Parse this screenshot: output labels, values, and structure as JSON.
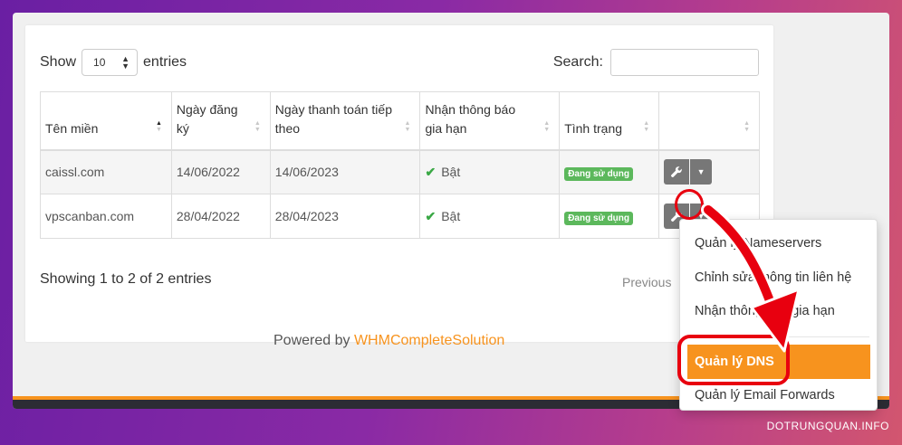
{
  "controls": {
    "show_label": "Show",
    "entries_value": "10",
    "entries_label": "entries",
    "search_label": "Search:",
    "search_value": ""
  },
  "table": {
    "headers": [
      "Tên miền",
      "Ngày đăng ký",
      "Ngày thanh toán tiếp theo",
      "Nhận thông báo gia hạn",
      "Tình trạng",
      ""
    ],
    "rows": [
      {
        "domain": "caissl.com",
        "registered": "14/06/2022",
        "next_due": "14/06/2023",
        "renewal_notice": "Bật",
        "status": "Đang sử dụng"
      },
      {
        "domain": "vpscanban.com",
        "registered": "28/04/2022",
        "next_due": "28/04/2023",
        "renewal_notice": "Bật",
        "status": "Đang sử dụng"
      }
    ]
  },
  "footer": {
    "showing_text": "Showing 1 to 2 of 2 entries",
    "previous_label": "Previous",
    "powered_prefix": "Powered by",
    "powered_link": "WHMCompleteSolution"
  },
  "dropdown": {
    "items": [
      "Quản lý Nameservers",
      "Chỉnh sửa thông tin liên hệ",
      "Nhận thông báo gia hạn",
      "Quản lý DNS",
      "Quản lý Email Forwards"
    ],
    "active_index": 3
  },
  "watermark": "DOTRUNGQUAN.INFO",
  "colors": {
    "accent_orange": "#f7931e",
    "status_green": "#5cb85c",
    "annotation_red": "#e8000f",
    "primary_blue": "#3b82f6"
  }
}
